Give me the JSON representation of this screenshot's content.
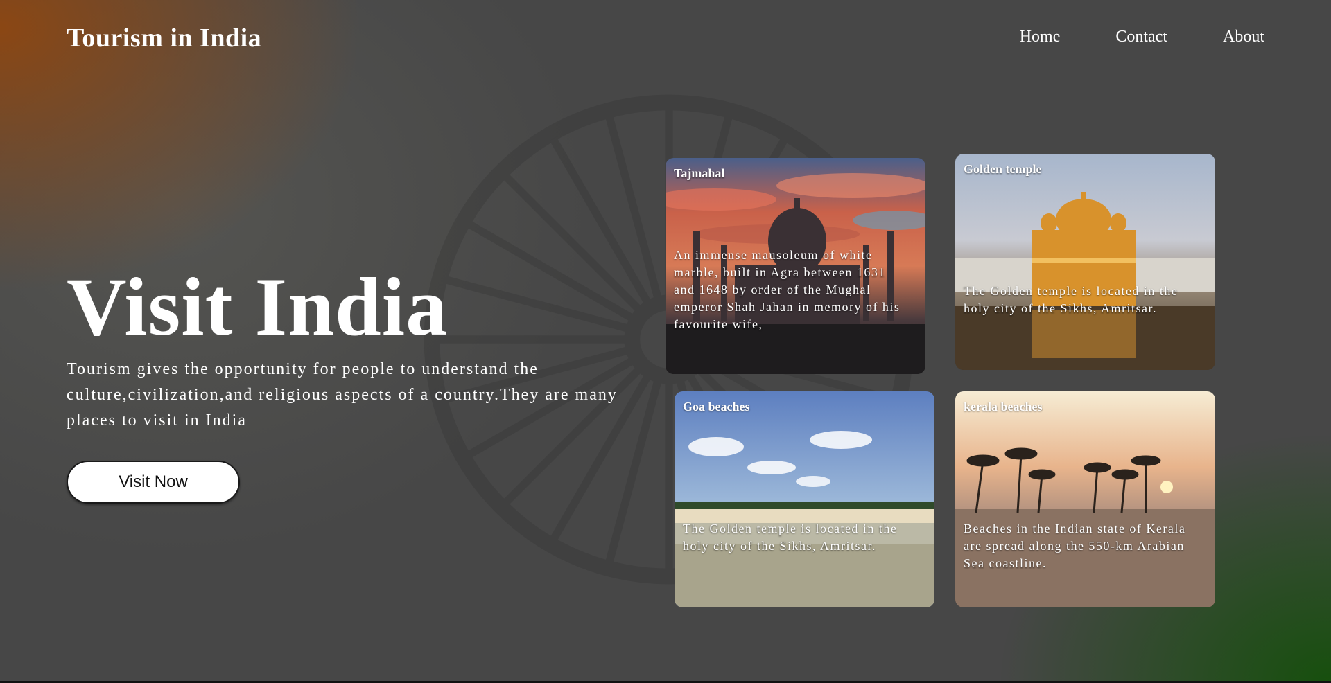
{
  "header": {
    "logo": "Tourism in India",
    "nav": [
      {
        "label": "Home"
      },
      {
        "label": "Contact"
      },
      {
        "label": "About"
      }
    ]
  },
  "hero": {
    "title": "Visit India",
    "text": "Tourism gives the opportunity for people to understand the culture,civilization,and religious aspects of a country.They are many places to visit in India",
    "button": "Visit Now"
  },
  "cards": [
    {
      "title": "Tajmahal",
      "description": "An immense mausoleum of white marble, built in Agra between 1631 and 1648 by order of the Mughal emperor Shah Jahan in memory of his favourite wife,",
      "image": "taj-mahal-sunset"
    },
    {
      "title": "Golden temple",
      "description": "The Golden temple is located in the holy city of the Sikhs, Amritsar.",
      "image": "golden-temple"
    },
    {
      "title": "Goa beaches",
      "description": "The Golden temple is located in the holy city of the Sikhs, Amritsar.",
      "image": "goa-beach"
    },
    {
      "title": "kerala beaches",
      "description": "Beaches in the Indian state of Kerala are spread along the 550-km Arabian Sea coastline.",
      "image": "kerala-sunset-palms"
    }
  ],
  "colors": {
    "background": "#474747",
    "accent_saffron": "#96460a",
    "accent_green": "#14500a",
    "button_bg": "#ffffff",
    "button_text": "#111111"
  }
}
